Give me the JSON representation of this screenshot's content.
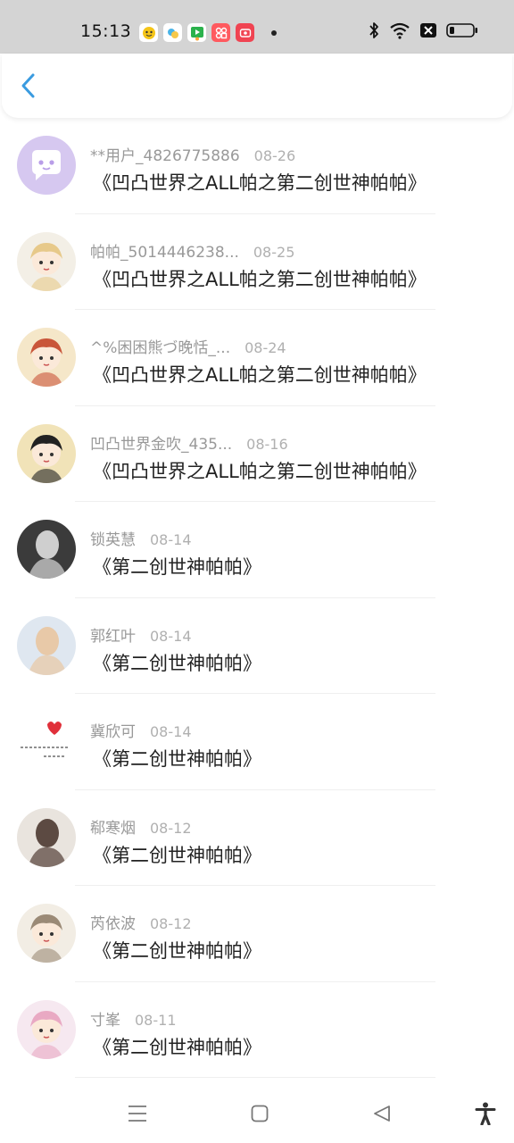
{
  "status_bar": {
    "time": "15:13",
    "app_icons": [
      "chat-app-icon",
      "weather-app-icon",
      "video-app-icon",
      "photo-app-icon",
      "camera-app-icon"
    ],
    "system_icons": [
      "bluetooth-icon",
      "wifi-icon",
      "sim-icon",
      "battery-icon"
    ]
  },
  "header": {
    "back_icon": "chevron-left-icon"
  },
  "colors": {
    "accent": "#3a9be0",
    "name_text": "#999999",
    "title_text": "#222222"
  },
  "items": [
    {
      "name": "**用户_4826775886",
      "date": "08-26",
      "title": "《凹凸世界之ALL帕之第二创世神帕帕》",
      "avatar": "chat-bubble-avatar"
    },
    {
      "name": "帕帕_5014446238...",
      "date": "08-25",
      "title": "《凹凸世界之ALL帕之第二创世神帕帕》",
      "avatar": "anime-avatar"
    },
    {
      "name": "^%困困熊づ晚恬_...",
      "date": "08-24",
      "title": "《凹凸世界之ALL帕之第二创世神帕帕》",
      "avatar": "anime-avatar"
    },
    {
      "name": "凹凸世界金吹_435...",
      "date": "08-16",
      "title": "《凹凸世界之ALL帕之第二创世神帕帕》",
      "avatar": "anime-avatar"
    },
    {
      "name": "锁英慧",
      "date": "08-14",
      "title": "《第二创世神帕帕》",
      "avatar": "photo-avatar"
    },
    {
      "name": "郭红叶",
      "date": "08-14",
      "title": "《第二创世神帕帕》",
      "avatar": "photo-avatar"
    },
    {
      "name": "冀欣可",
      "date": "08-14",
      "title": "《第二创世神帕帕》",
      "avatar": "heart-avatar"
    },
    {
      "name": "郗寒烟",
      "date": "08-12",
      "title": "《第二创世神帕帕》",
      "avatar": "photo-avatar"
    },
    {
      "name": "芮依波",
      "date": "08-12",
      "title": "《第二创世神帕帕》",
      "avatar": "anime-avatar"
    },
    {
      "name": "寸峯",
      "date": "08-11",
      "title": "《第二创世神帕帕》",
      "avatar": "anime-avatar"
    }
  ],
  "nav_bar": {
    "buttons": [
      "menu-icon",
      "home-icon",
      "back-triangle-icon",
      "accessibility-icon"
    ]
  }
}
